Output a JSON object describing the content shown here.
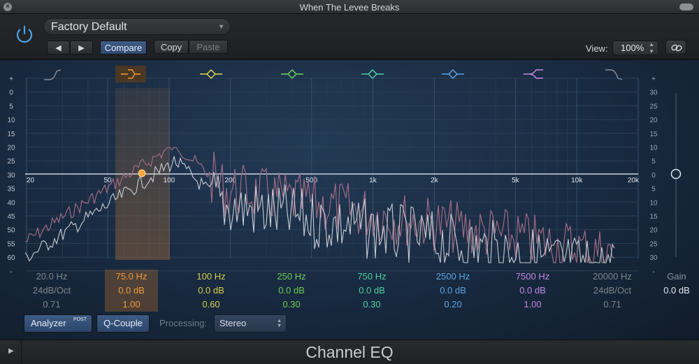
{
  "window": {
    "title": "When The Levee Breaks"
  },
  "header": {
    "preset_name": "Factory Default",
    "compare_label": "Compare",
    "copy_label": "Copy",
    "paste_label": "Paste",
    "view_label": "View:",
    "view_value": "100%"
  },
  "graph": {
    "left_scale": [
      "+",
      "0",
      "5",
      "10",
      "15",
      "20",
      "25",
      "30",
      "35",
      "40",
      "45",
      "50",
      "55",
      "60",
      "-"
    ],
    "right_scale": [
      "+",
      "30",
      "25",
      "20",
      "15",
      "10",
      "5",
      "0",
      "5",
      "10",
      "15",
      "20",
      "25",
      "30",
      "-"
    ],
    "freq_ticks": [
      "20",
      "50",
      "100",
      "200",
      "500",
      "1k",
      "2k",
      "5k",
      "10k",
      "20k"
    ],
    "band_colors": [
      "#8a8f96",
      "#f19a3a",
      "#e3d94c",
      "#74d45d",
      "#4fd3a4",
      "#5aa6e6",
      "#c98ae6",
      "#8a8f96"
    ]
  },
  "bands": [
    {
      "freq": "20.0 Hz",
      "gain": "24dB/Oct",
      "q": "0.71",
      "color": "#7f858c"
    },
    {
      "freq": "75.0 Hz",
      "gain": "0.0 dB",
      "q": "1.00",
      "color": "#f19a3a"
    },
    {
      "freq": "100 Hz",
      "gain": "0.0 dB",
      "q": "0.60",
      "color": "#d8cf4a"
    },
    {
      "freq": "250 Hz",
      "gain": "0.0 dB",
      "q": "0.30",
      "color": "#6fcb56"
    },
    {
      "freq": "750 Hz",
      "gain": "0.0 dB",
      "q": "0.30",
      "color": "#4ecfa3"
    },
    {
      "freq": "2500 Hz",
      "gain": "0.0 dB",
      "q": "0.20",
      "color": "#5aa3e2"
    },
    {
      "freq": "7500 Hz",
      "gain": "0.0 dB",
      "q": "1.00",
      "color": "#c487e3"
    },
    {
      "freq": "20000 Hz",
      "gain": "24dB/Oct",
      "q": "0.71",
      "color": "#7f858c"
    }
  ],
  "gain": {
    "label": "Gain",
    "value": "0.0 dB"
  },
  "bottom": {
    "analyzer_label": "Analyzer",
    "analyzer_badge": "POST",
    "qcouple_label": "Q-Couple",
    "processing_label": "Processing:",
    "processing_value": "Stereo"
  },
  "footer": {
    "plugin_name": "Channel EQ"
  }
}
